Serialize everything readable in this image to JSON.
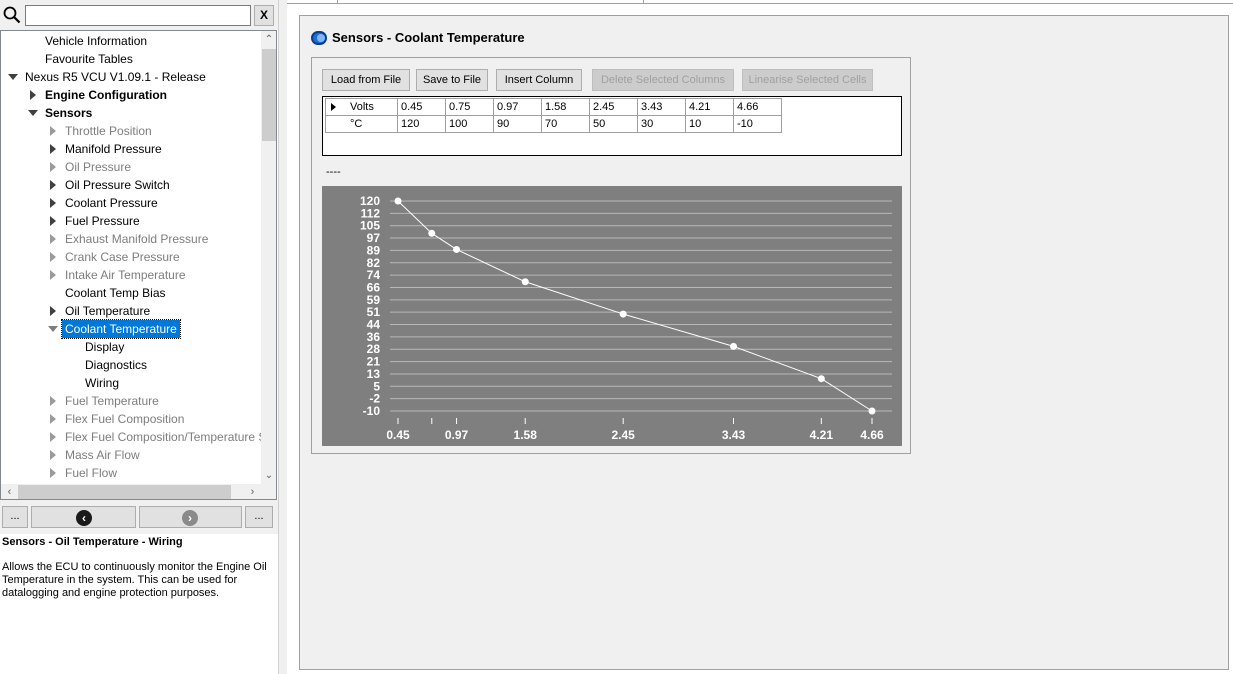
{
  "search": {
    "placeholder": "",
    "value": "",
    "clear_label": "X"
  },
  "tree": [
    {
      "label": "Vehicle Information",
      "level": 1,
      "arrow": "none",
      "style": "normal"
    },
    {
      "label": "Favourite Tables",
      "level": 1,
      "arrow": "none",
      "style": "normal"
    },
    {
      "label": "Nexus R5 VCU V1.09.1 - Release",
      "level": 0,
      "arrow": "down",
      "style": "normal"
    },
    {
      "label": "Engine Configuration",
      "level": 1,
      "arrow": "right",
      "style": "bold"
    },
    {
      "label": "Sensors",
      "level": 1,
      "arrow": "down",
      "style": "bold"
    },
    {
      "label": "Throttle Position",
      "level": 2,
      "arrow": "right",
      "style": "disabled"
    },
    {
      "label": "Manifold Pressure",
      "level": 2,
      "arrow": "right",
      "style": "normal"
    },
    {
      "label": "Oil Pressure",
      "level": 2,
      "arrow": "right",
      "style": "disabled"
    },
    {
      "label": "Oil Pressure Switch",
      "level": 2,
      "arrow": "right",
      "style": "normal"
    },
    {
      "label": "Coolant Pressure",
      "level": 2,
      "arrow": "right",
      "style": "normal"
    },
    {
      "label": "Fuel Pressure",
      "level": 2,
      "arrow": "right",
      "style": "normal"
    },
    {
      "label": "Exhaust Manifold Pressure",
      "level": 2,
      "arrow": "right",
      "style": "disabled"
    },
    {
      "label": "Crank Case Pressure",
      "level": 2,
      "arrow": "right",
      "style": "disabled"
    },
    {
      "label": "Intake Air Temperature",
      "level": 2,
      "arrow": "right",
      "style": "disabled"
    },
    {
      "label": "Coolant Temp Bias",
      "level": 2,
      "arrow": "none",
      "style": "normal"
    },
    {
      "label": "Oil Temperature",
      "level": 2,
      "arrow": "right",
      "style": "normal"
    },
    {
      "label": "Coolant Temperature",
      "level": 2,
      "arrow": "down-grey",
      "style": "selected"
    },
    {
      "label": "Display",
      "level": 3,
      "arrow": "none",
      "style": "normal"
    },
    {
      "label": "Diagnostics",
      "level": 3,
      "arrow": "none",
      "style": "normal"
    },
    {
      "label": "Wiring",
      "level": 3,
      "arrow": "none",
      "style": "normal"
    },
    {
      "label": "Fuel Temperature",
      "level": 2,
      "arrow": "right",
      "style": "disabled"
    },
    {
      "label": "Flex Fuel Composition",
      "level": 2,
      "arrow": "right",
      "style": "disabled"
    },
    {
      "label": "Flex Fuel Composition/Temperature S",
      "level": 2,
      "arrow": "right",
      "style": "disabled"
    },
    {
      "label": "Mass Air Flow",
      "level": 2,
      "arrow": "right",
      "style": "disabled"
    },
    {
      "label": "Fuel Flow",
      "level": 2,
      "arrow": "right",
      "style": "disabled"
    }
  ],
  "nav": {
    "more_left": "...",
    "more_right": "..."
  },
  "help": {
    "title": "Sensors - Oil Temperature - Wiring",
    "text": "Allows the ECU to continuously monitor the Engine Oil Temperature in the system. This can be used for datalogging and engine protection purposes."
  },
  "section": {
    "title": "Sensors - Coolant Temperature"
  },
  "toolbar": {
    "load": "Load from File",
    "save": "Save to File",
    "insert": "Insert Column",
    "delete": "Delete Selected Columns",
    "linearise": "Linearise Selected Cells"
  },
  "table": {
    "row1_label": "Volts",
    "row2_label": "°C",
    "volts": [
      "0.45",
      "0.75",
      "0.97",
      "1.58",
      "2.45",
      "3.43",
      "4.21",
      "4.66"
    ],
    "temps": [
      "120",
      "100",
      "90",
      "70",
      "50",
      "30",
      "10",
      "-10"
    ]
  },
  "dashes": "----",
  "chart_data": {
    "type": "line",
    "x": [
      0.45,
      0.75,
      0.97,
      1.58,
      2.45,
      3.43,
      4.21,
      4.66
    ],
    "y": [
      120,
      100,
      90,
      70,
      50,
      30,
      10,
      -10
    ],
    "x_tick_labels": [
      "0.45",
      "0.97",
      "1.58",
      "2.45",
      "3.43",
      "4.21",
      "4.66"
    ],
    "y_tick_labels": [
      "120",
      "112",
      "105",
      "97",
      "89",
      "82",
      "74",
      "66",
      "59",
      "51",
      "44",
      "36",
      "28",
      "21",
      "13",
      "5",
      "-2",
      "-10"
    ],
    "xlim": [
      0.45,
      4.66
    ],
    "ylim": [
      -10,
      120
    ],
    "grid": true,
    "background": "#7f7f7f",
    "line_color": "#ffffff"
  }
}
